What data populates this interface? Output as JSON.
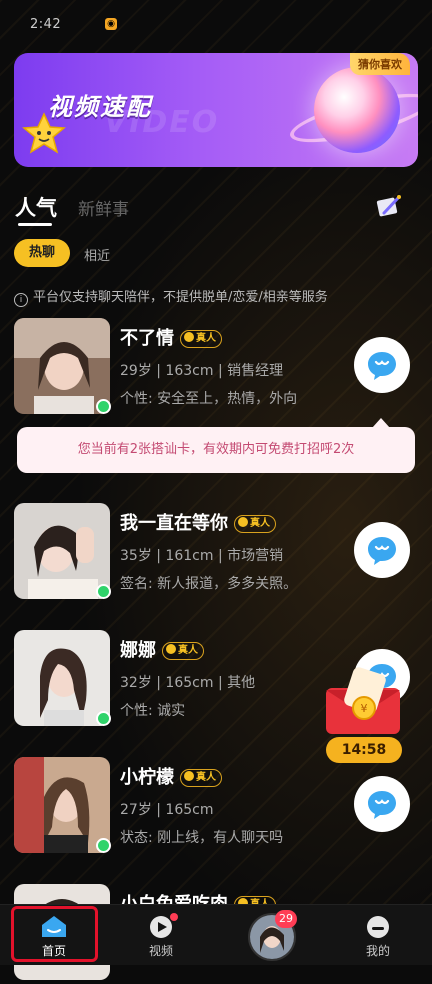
{
  "status_bar": {
    "time": "2:42",
    "app_icon": "weibo-icon"
  },
  "banner": {
    "title": "视频速配",
    "ghost_text": "VIDEO",
    "badge": "猜你喜欢"
  },
  "tabs": [
    {
      "label": "人气",
      "active": true
    },
    {
      "label": "新鲜事",
      "active": false
    }
  ],
  "filters": [
    {
      "label": "热聊",
      "active": true
    },
    {
      "label": "相近",
      "active": false
    }
  ],
  "notice": "平台仅支持聊天陪伴，不提供脱单/恋爱/相亲等服务",
  "verified_label": "真人",
  "users": [
    {
      "name": "不了情",
      "stats": "29岁 | 163cm | 销售经理",
      "bio": "个性: 安全至上，热情，外向",
      "online": true
    },
    {
      "name": "我一直在等你",
      "stats": "35岁 | 161cm | 市场营销",
      "bio": "签名: 新人报道，多多关照。",
      "online": true
    },
    {
      "name": "娜娜",
      "stats": "32岁 | 165cm | 其他",
      "bio": "个性: 诚实",
      "online": true
    },
    {
      "name": "小柠檬",
      "stats": "27岁 | 165cm",
      "bio": "状态: 刚上线，有人聊天吗",
      "online": true
    },
    {
      "name": "小白兔爱吃肉",
      "stats": "",
      "bio": "",
      "online": true
    }
  ],
  "toast": "您当前有2张搭讪卡，有效期内可免费打招呼2次",
  "red_envelope": {
    "timer": "14:58"
  },
  "nav": [
    {
      "label": "首页",
      "icon": "home-icon",
      "active": true
    },
    {
      "label": "视频",
      "icon": "play-icon",
      "active": false
    },
    {
      "label": "",
      "icon": "avatar",
      "badge": "29"
    },
    {
      "label": "我的",
      "icon": "profile-icon",
      "active": false
    }
  ],
  "colors": {
    "accent": "#f6c023",
    "banner": "#a45cf6",
    "online": "#2fd36a",
    "highlight": "#e3122b"
  }
}
